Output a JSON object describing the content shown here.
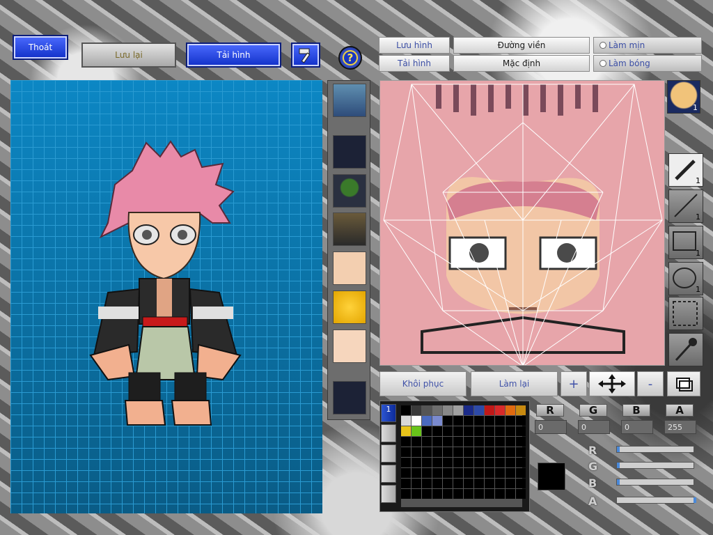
{
  "top_buttons": {
    "exit": "Thoát",
    "save": "Lưu lại",
    "reload": "Tải hình",
    "hammer_icon": "hammer-icon",
    "help_icon": "question-icon"
  },
  "editor_tabs": {
    "save": "Lưu hình",
    "outline": "Đường viền",
    "smooth": "Làm mịn",
    "load": "Tải hình",
    "default": "Mặc định",
    "shade": "Làm bóng"
  },
  "editor_buttons": {
    "restore": "Khôi phục",
    "redo": "Làm lại",
    "plus": "+",
    "move_icon": "move-arrows-icon",
    "minus": "-",
    "layers_icon": "layers-icon"
  },
  "tools": [
    {
      "name": "pen",
      "icon": "pen-icon",
      "count": "1"
    },
    {
      "name": "line",
      "icon": "line-icon",
      "count": "1"
    },
    {
      "name": "rectangle",
      "icon": "rectangle-icon",
      "count": "1"
    },
    {
      "name": "ellipse",
      "icon": "ellipse-icon",
      "count": "1"
    },
    {
      "name": "select",
      "icon": "select-rect-icon",
      "count": ""
    },
    {
      "name": "eyedropper",
      "icon": "eyedropper-icon",
      "count": ""
    }
  ],
  "face_thumb_count": "1",
  "color": {
    "r_label": "R",
    "g_label": "G",
    "b_label": "B",
    "a_label": "A",
    "r": "0",
    "g": "0",
    "b": "0",
    "a": "255",
    "current": "#000000"
  },
  "palette_tab_number": "1",
  "palette": [
    "#000000",
    "#3a3a3a",
    "#555555",
    "#6e6e6e",
    "#888888",
    "#a0a0a0",
    "#1a2a88",
    "#2d4aa8",
    "#c01818",
    "#d82a2a",
    "#e06a10",
    "#c88a10",
    "#d8d8d8",
    "#ffffff",
    "#4a6abf",
    "#7a8acf",
    "#000000",
    "#000000",
    "#000000",
    "#000000",
    "#000000",
    "#000000",
    "#000000",
    "#000000",
    "#e8c41a",
    "#68c41a",
    "#000000",
    "#000000",
    "#000000",
    "#000000",
    "#000000",
    "#000000",
    "#000000",
    "#000000",
    "#000000",
    "#000000"
  ]
}
